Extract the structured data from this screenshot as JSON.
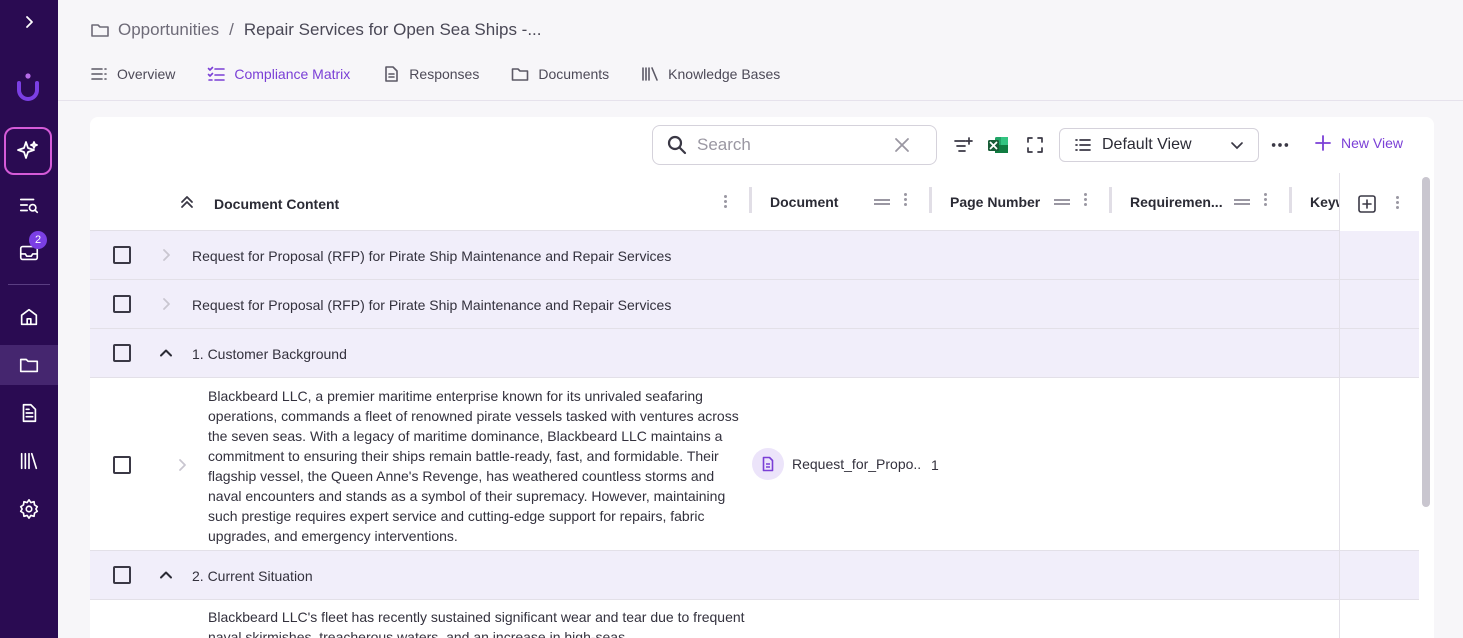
{
  "rail": {
    "notification_count": "2"
  },
  "breadcrumb": {
    "root": "Opportunities",
    "separator": "/",
    "current": "Repair Services for Open Sea Ships -..."
  },
  "tabs": [
    {
      "label": "Overview",
      "icon": "list-icon"
    },
    {
      "label": "Compliance Matrix",
      "icon": "checklist-icon",
      "selected": true
    },
    {
      "label": "Responses",
      "icon": "document-icon"
    },
    {
      "label": "Documents",
      "icon": "folder-icon"
    },
    {
      "label": "Knowledge Bases",
      "icon": "library-icon"
    }
  ],
  "toolbar": {
    "search_placeholder": "Search",
    "view_label": "Default View",
    "new_view_label": "New View"
  },
  "columns": {
    "content": "Document Content",
    "document": "Document",
    "page": "Page Number",
    "requirement": "Requiremen...",
    "keywords": "Keyw"
  },
  "rows": [
    {
      "type": "section",
      "text": "Request for Proposal (RFP) for Pirate Ship Maintenance and Repair Services",
      "expanded": false
    },
    {
      "type": "section",
      "text": "Request for Proposal (RFP) for Pirate Ship Maintenance and Repair Services",
      "expanded": false
    },
    {
      "type": "section",
      "text": "1. Customer Background",
      "expanded": true
    },
    {
      "type": "item",
      "text": "Blackbeard LLC, a premier maritime enterprise known for its unrivaled seafaring operations, commands a fleet of renowned pirate vessels tasked with ventures across the seven seas. With a legacy of maritime dominance, Blackbeard LLC maintains a commitment to ensuring their ships remain battle-ready, fast, and formidable. Their flagship vessel, the Queen Anne's Revenge, has weathered countless storms and naval encounters and stands as a symbol of their supremacy. However, maintaining such prestige requires expert service and cutting-edge support for repairs, fabric upgrades, and emergency interventions.",
      "document": "Request_for_Propo..",
      "page": "1"
    },
    {
      "type": "section",
      "text": "2. Current Situation",
      "expanded": true
    },
    {
      "type": "item",
      "text": "Blackbeard LLC's fleet has recently sustained significant wear and tear due to frequent naval skirmishes, treacherous waters, and an increase in high-seas"
    }
  ],
  "colors": {
    "rail": "#2a0b52",
    "accent": "#7a3fd6",
    "section_row": "#f1eefa"
  }
}
